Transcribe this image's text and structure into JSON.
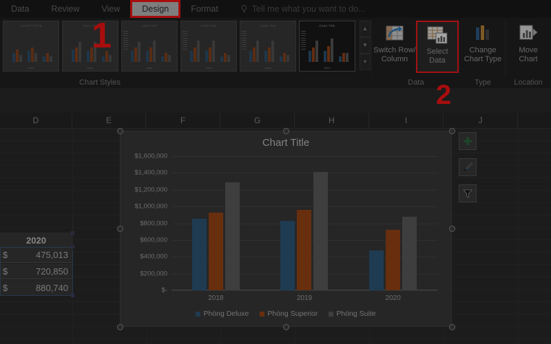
{
  "ribbon": {
    "tabs": [
      {
        "label": "Data",
        "active": false
      },
      {
        "label": "Review",
        "active": false
      },
      {
        "label": "View",
        "active": false
      },
      {
        "label": "Design",
        "active": true
      },
      {
        "label": "Format",
        "active": false
      }
    ],
    "tell_me": "Tell me what you want to do...",
    "tell_me_icon": "lightbulb-icon",
    "groups": [
      {
        "name": "chart-styles",
        "label": "Chart Styles"
      },
      {
        "name": "data",
        "label": "Data"
      },
      {
        "name": "type",
        "label": "Type"
      },
      {
        "name": "location",
        "label": "Location"
      }
    ],
    "commands": [
      {
        "name": "switch-row-column",
        "label": "Switch Row/\nColumn",
        "icon": "switch-row-column-icon",
        "highlighted": false
      },
      {
        "name": "select-data",
        "label": "Select\nData",
        "icon": "select-data-icon",
        "highlighted": true
      },
      {
        "name": "change-chart-type",
        "label": "Change\nChart Type",
        "icon": "change-chart-type-icon",
        "highlighted": false
      },
      {
        "name": "move-chart",
        "label": "Move\nChart",
        "icon": "move-chart-icon",
        "highlighted": false
      }
    ],
    "gallery_scroll": {
      "up": "▲",
      "down": "▼",
      "more": "▾"
    },
    "style_thumbnails": [
      {
        "title": "CHART TITLE",
        "selected": false
      },
      {
        "title": "Chart Title",
        "selected": false
      },
      {
        "title": "Chart Title",
        "selected": false
      },
      {
        "title": "Chart Title",
        "selected": false
      },
      {
        "title": "Chart Title",
        "selected": false
      },
      {
        "title": "Chart Title",
        "selected": true
      }
    ]
  },
  "callouts": [
    {
      "name": "callout-1",
      "text": "1"
    },
    {
      "name": "callout-2",
      "text": "2"
    }
  ],
  "sheet": {
    "column_headers": [
      "D",
      "E",
      "F",
      "G",
      "H",
      "I",
      "J"
    ],
    "selected_column": "D",
    "cells": [
      {
        "currency": "",
        "value": "2020",
        "header": true
      },
      {
        "currency": "$",
        "value": "475,013",
        "header": false
      },
      {
        "currency": "$",
        "value": "720,850",
        "header": false
      },
      {
        "currency": "$",
        "value": "880,740",
        "header": false
      }
    ]
  },
  "chart": {
    "title": "Chart Title",
    "side_buttons": [
      {
        "name": "chart-elements-button",
        "icon": "plus-icon"
      },
      {
        "name": "chart-styles-button",
        "icon": "paintbrush-icon"
      },
      {
        "name": "chart-filters-button",
        "icon": "funnel-filter-icon"
      }
    ]
  },
  "chart_data": {
    "type": "bar",
    "title": "Chart Title",
    "xlabel": "",
    "ylabel": "",
    "categories": [
      "2018",
      "2019",
      "2020"
    ],
    "series": [
      {
        "name": "Phòng Deluxe",
        "color": "#2e5a7d",
        "values": [
          850000,
          830000,
          475013
        ]
      },
      {
        "name": "Phòng Superior",
        "color": "#9e4818",
        "values": [
          930000,
          960000,
          720850
        ]
      },
      {
        "name": "Phòng Suite",
        "color": "#5e5e5e",
        "values": [
          1290000,
          1415000,
          880740
        ]
      }
    ],
    "ylim": [
      0,
      1600000
    ],
    "ytick_labels": [
      "$1,600,000",
      "$1,400,000",
      "$1,200,000",
      "$1,000,000",
      "$800,000",
      "$600,000",
      "$400,000",
      "$200,000",
      "$-"
    ],
    "ytick_values": [
      1600000,
      1400000,
      1200000,
      1000000,
      800000,
      600000,
      400000,
      200000,
      0
    ],
    "grid": true,
    "legend_position": "bottom"
  }
}
